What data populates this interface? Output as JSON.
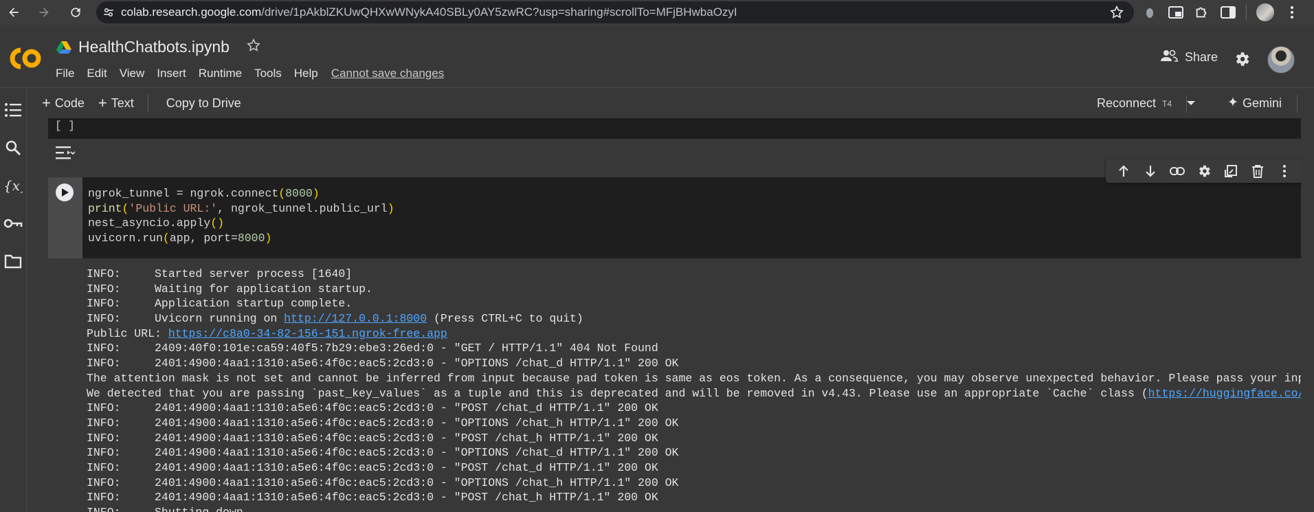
{
  "browser": {
    "url_host": "colab.research.google.com",
    "url_path": "/drive/1pAkblZKUwQHXwWNykA40SBLy0AY5zwRC?usp=sharing#scrollTo=MFjBHwbaOzyI"
  },
  "header": {
    "notebook_title": "HealthChatbots.ipynb",
    "menu": [
      "File",
      "Edit",
      "View",
      "Insert",
      "Runtime",
      "Tools",
      "Help"
    ],
    "cannot_save": "Cannot save changes",
    "share_label": "Share"
  },
  "toolbar": {
    "code_label": "Code",
    "text_label": "Text",
    "copy_to_drive": "Copy to Drive",
    "reconnect": "Reconnect",
    "runtime_type": "T4",
    "gemini": "Gemini"
  },
  "cells": {
    "prev_cell_bracket": "[ ]",
    "code_lines": [
      "ngrok_tunnel = ngrok.connect(8000)",
      "print('Public URL:', ngrok_tunnel.public_url)",
      "nest_asyncio.apply()",
      "uvicorn.run(app, port=8000)"
    ]
  },
  "output": {
    "lines": [
      {
        "text": "INFO:     Started server process [1640]"
      },
      {
        "text": "INFO:     Waiting for application startup."
      },
      {
        "text": "INFO:     Application startup complete."
      },
      {
        "text": "INFO:     Uvicorn running on ",
        "link": "http://127.0.0.1:8000",
        "after": " (Press CTRL+C to quit)"
      },
      {
        "text": "Public URL: ",
        "link": "https://c8a0-34-82-156-151.ngrok-free.app",
        "after": ""
      },
      {
        "text": "INFO:     2409:40f0:101e:ca59:40f5:7b29:ebe3:26ed:0 - \"GET / HTTP/1.1\" 404 Not Found"
      },
      {
        "text": "INFO:     2401:4900:4aa1:1310:a5e6:4f0c:eac5:2cd3:0 - \"OPTIONS /chat_d HTTP/1.1\" 200 OK"
      },
      {
        "text": "The attention mask is not set and cannot be inferred from input because pad token is same as eos token. As a consequence, you may observe unexpected behavior. Please pass your input's"
      },
      {
        "text": "We detected that you are passing `past_key_values` as a tuple and this is deprecated and will be removed in v4.43. Please use an appropriate `Cache` class (",
        "link": "https://huggingface.co/docs/",
        "after": ""
      },
      {
        "text": "INFO:     2401:4900:4aa1:1310:a5e6:4f0c:eac5:2cd3:0 - \"POST /chat_d HTTP/1.1\" 200 OK"
      },
      {
        "text": "INFO:     2401:4900:4aa1:1310:a5e6:4f0c:eac5:2cd3:0 - \"OPTIONS /chat_h HTTP/1.1\" 200 OK"
      },
      {
        "text": "INFO:     2401:4900:4aa1:1310:a5e6:4f0c:eac5:2cd3:0 - \"POST /chat_h HTTP/1.1\" 200 OK"
      },
      {
        "text": "INFO:     2401:4900:4aa1:1310:a5e6:4f0c:eac5:2cd3:0 - \"OPTIONS /chat_d HTTP/1.1\" 200 OK"
      },
      {
        "text": "INFO:     2401:4900:4aa1:1310:a5e6:4f0c:eac5:2cd3:0 - \"POST /chat_d HTTP/1.1\" 200 OK"
      },
      {
        "text": "INFO:     2401:4900:4aa1:1310:a5e6:4f0c:eac5:2cd3:0 - \"OPTIONS /chat_h HTTP/1.1\" 200 OK"
      },
      {
        "text": "INFO:     2401:4900:4aa1:1310:a5e6:4f0c:eac5:2cd3:0 - \"POST /chat_h HTTP/1.1\" 200 OK"
      },
      {
        "text": "INFO:     Shutting down"
      }
    ]
  },
  "icons": {
    "rail": [
      "table-of-contents-icon",
      "search-icon",
      "variables-icon",
      "secrets-key-icon",
      "files-folder-icon"
    ],
    "cell_toolbar": [
      "move-up-icon",
      "move-down-icon",
      "link-icon",
      "settings-icon",
      "mirror-cell-icon",
      "delete-icon",
      "more-icon"
    ]
  },
  "colors": {
    "background": "#383838",
    "code_background": "#1e1e1e",
    "link": "#4fa6ff",
    "logo_orange": "#f9ab00"
  }
}
